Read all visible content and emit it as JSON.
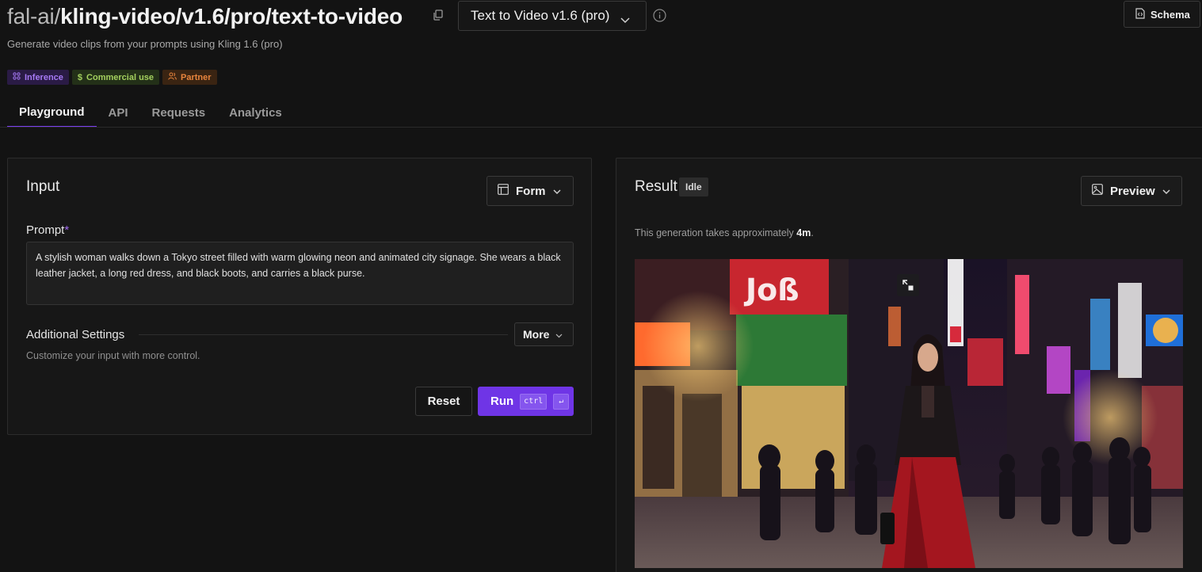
{
  "header": {
    "owner": "fal-ai/",
    "path": "kling-video/v1.6/pro/text-to-video",
    "endpoint_select": "Text to Video v1.6 (pro)",
    "schema_label": "Schema",
    "subtitle": "Generate video clips from your prompts using Kling 1.6 (pro)"
  },
  "badges": [
    {
      "label": "Inference",
      "icon": "inference-icon",
      "color": "#a679f4"
    },
    {
      "label": "Commercial use",
      "icon": "dollar-icon",
      "color": "#a3d05e"
    },
    {
      "label": "Partner",
      "icon": "partner-icon",
      "color": "#e8843d"
    }
  ],
  "tabs": [
    {
      "label": "Playground",
      "active": true
    },
    {
      "label": "API",
      "active": false
    },
    {
      "label": "Requests",
      "active": false
    },
    {
      "label": "Analytics",
      "active": false
    }
  ],
  "input_panel": {
    "title": "Input",
    "mode_toggle": "Form",
    "prompt_label": "Prompt",
    "required_marker": "*",
    "prompt_value": "A stylish woman walks down a Tokyo street filled with warm glowing neon and animated city signage. She wears a black leather jacket, a long red dress, and black boots, and carries a black purse.",
    "additional_settings": {
      "label": "Additional Settings",
      "more_button": "More",
      "hint": "Customize your input with more control."
    },
    "reset_button": "Reset",
    "run_button": "Run",
    "run_shortcut": [
      "ctrl",
      "↵"
    ]
  },
  "result_panel": {
    "title": "Result",
    "status": "Idle",
    "view_toggle": "Preview",
    "eta_prefix": "This generation takes approximately ",
    "eta_value": "4m",
    "eta_suffix": ".",
    "preview_image": "tokyo-neon-street-woman-red-dress"
  },
  "colors": {
    "accent": "#6f35e6",
    "background": "#131313",
    "panel": "#171717"
  }
}
